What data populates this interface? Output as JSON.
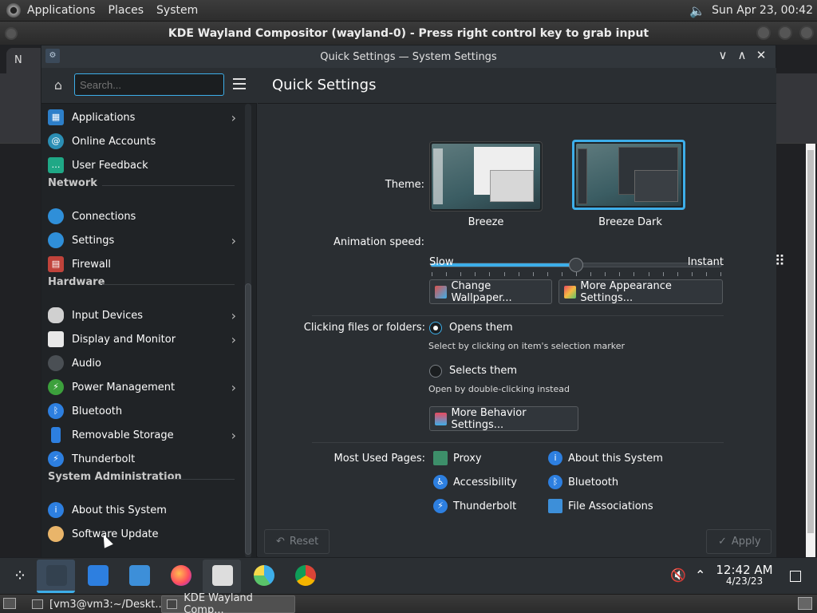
{
  "gnome_panel": {
    "menus": [
      "Applications",
      "Places",
      "System"
    ],
    "clock": "Sun Apr 23, 00:42"
  },
  "host_window": {
    "title": "KDE Wayland Compositor (wayland-0) - Press right control key to grab input"
  },
  "chrome_behind": {
    "tab_label": "N"
  },
  "window": {
    "title": "Quick Settings — System Settings",
    "minimize": "∨",
    "maximize": "∧",
    "close": "✕"
  },
  "sidebar": {
    "search_placeholder": "Search...",
    "items_top": [
      {
        "label": "Applications",
        "icon": "applications-icon",
        "chevron": true
      },
      {
        "label": "Online Accounts",
        "icon": "online-accounts-icon",
        "chevron": false
      },
      {
        "label": "User Feedback",
        "icon": "user-feedback-icon",
        "chevron": false
      }
    ],
    "sections": {
      "network": "Network",
      "hardware": "Hardware",
      "system_admin": "System Administration"
    },
    "network_items": [
      {
        "label": "Connections",
        "chevron": false
      },
      {
        "label": "Settings",
        "chevron": true
      },
      {
        "label": "Firewall",
        "chevron": false
      }
    ],
    "hardware_items": [
      {
        "label": "Input Devices",
        "chevron": true
      },
      {
        "label": "Display and Monitor",
        "chevron": true
      },
      {
        "label": "Audio",
        "chevron": false
      },
      {
        "label": "Power Management",
        "chevron": true
      },
      {
        "label": "Bluetooth",
        "chevron": false
      },
      {
        "label": "Removable Storage",
        "chevron": true
      },
      {
        "label": "Thunderbolt",
        "chevron": false
      }
    ],
    "admin_items": [
      {
        "label": "About this System"
      },
      {
        "label": "Software Update"
      }
    ]
  },
  "main": {
    "title": "Quick Settings",
    "theme_label": "Theme:",
    "themes": [
      "Breeze",
      "Breeze Dark"
    ],
    "selected_theme": "Breeze Dark",
    "animation_label": "Animation speed:",
    "animation_slow": "Slow",
    "animation_instant": "Instant",
    "animation_value": 0.5,
    "change_wallpaper": "Change Wallpaper...",
    "more_appearance": "More Appearance Settings...",
    "clicking_label": "Clicking files or folders:",
    "opens_them": "Opens them",
    "opens_hint": "Select by clicking on item's selection marker",
    "selects_them": "Selects them",
    "selects_hint": "Open by double-clicking instead",
    "more_behavior": "More Behavior Settings...",
    "most_used_label": "Most Used Pages:",
    "most_used": [
      "Proxy",
      "About this System",
      "Accessibility",
      "Bluetooth",
      "Thunderbolt",
      "File Associations"
    ],
    "reset": "Reset",
    "apply": "Apply"
  },
  "taskbar": {
    "time": "12:42 AM",
    "date": "4/23/23"
  },
  "gnome_bottom": {
    "tasks": [
      "[vm3@vm3:~/Deskt...",
      "KDE Wayland Comp..."
    ]
  },
  "colors": {
    "accent": "#3daee9",
    "window_bg": "#2a2e32",
    "sidebar_bg": "#202326"
  }
}
